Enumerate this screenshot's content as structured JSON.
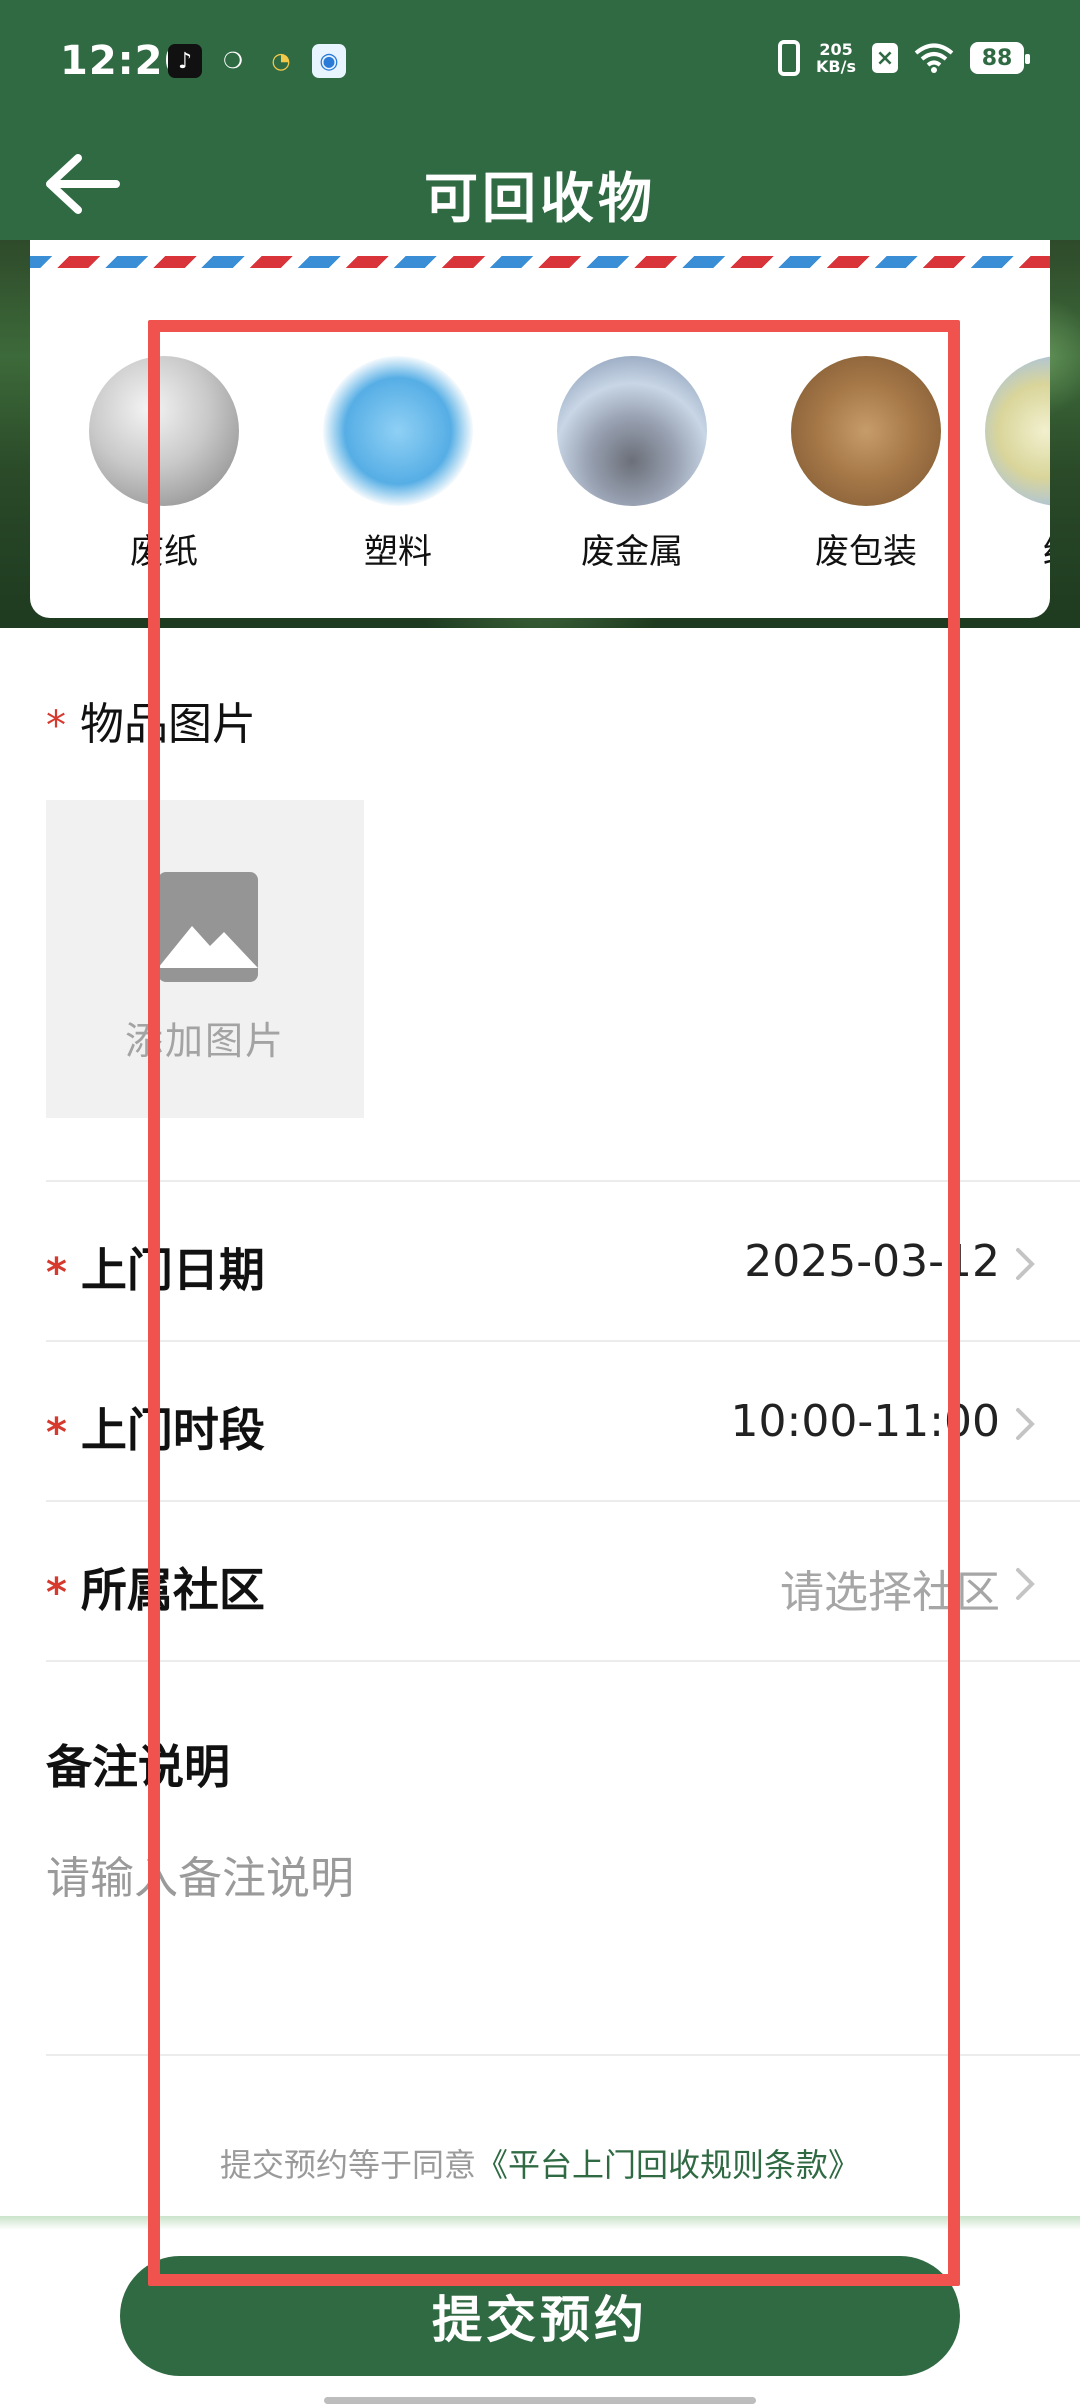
{
  "status_bar": {
    "time": "12:26",
    "net_speed_value": "205",
    "net_speed_unit": "KB/s",
    "battery": "88"
  },
  "header": {
    "title": "可回收物"
  },
  "categories": [
    {
      "label": "废纸",
      "icon": "crumpled-paper"
    },
    {
      "label": "塑料",
      "icon": "plastic-bottles"
    },
    {
      "label": "废金属",
      "icon": "scrap-metal"
    },
    {
      "label": "废包装",
      "icon": "cardboard-packaging"
    },
    {
      "label": "纺",
      "icon": "textile"
    }
  ],
  "form": {
    "photo": {
      "required_mark": "*",
      "title": "物品图片",
      "upload_label": "添加图片"
    },
    "date": {
      "required_mark": "*",
      "label": "上门日期",
      "value": "2025-03-12"
    },
    "time_slot": {
      "required_mark": "*",
      "label": "上门时段",
      "value": "10:00-11:00"
    },
    "community": {
      "required_mark": "*",
      "label": "所属社区",
      "placeholder": "请选择社区"
    },
    "remark": {
      "title": "备注说明",
      "placeholder": "请输入备注说明"
    }
  },
  "agreement": {
    "prefix": "提交预约等于同意",
    "link": "《平台上门回收规则条款》"
  },
  "submit": {
    "label": "提交预约"
  },
  "colors": {
    "brand_green": "#2f6a43",
    "required_red": "#d63a2f",
    "highlight_red": "#f0524d"
  }
}
